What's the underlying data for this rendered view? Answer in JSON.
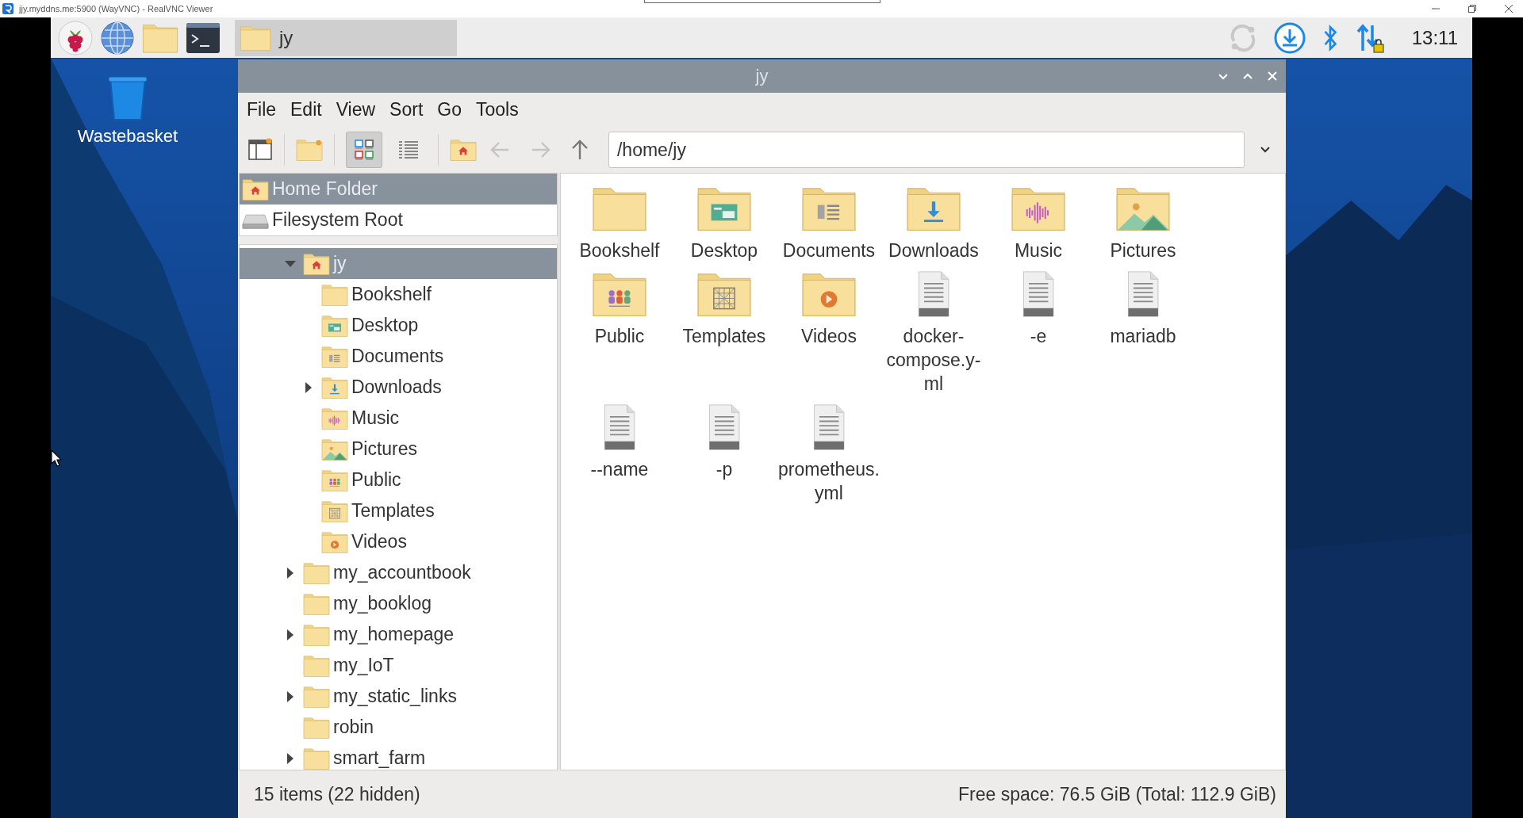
{
  "viewer_window": {
    "title": "jjy.myddns.me:5900 (WayVNC) - RealVNC Viewer"
  },
  "taskbar": {
    "task_buttons": [
      {
        "label": "jy",
        "selected": true
      }
    ],
    "clock": "13:11"
  },
  "desktop_icons": [
    {
      "label": "Wastebasket"
    }
  ],
  "file_manager": {
    "title": "jy",
    "menu": [
      "File",
      "Edit",
      "View",
      "Sort",
      "Go",
      "Tools"
    ],
    "view_modes": [
      {
        "kind": "icons",
        "selected": true
      },
      {
        "kind": "list",
        "selected": false
      }
    ],
    "navigation": [
      {
        "kind": "back",
        "disabled": true
      },
      {
        "kind": "forward",
        "disabled": true
      },
      {
        "kind": "up",
        "disabled": false
      }
    ],
    "path": "/home/jy",
    "places": [
      {
        "label": "Home Folder",
        "kind": "home",
        "selected": true
      },
      {
        "label": "Filesystem Root",
        "kind": "drive",
        "selected": false
      }
    ],
    "tree": [
      {
        "label": "jy",
        "kind": "home",
        "expandable": true,
        "expanded": true,
        "selected": true,
        "children": [
          {
            "label": "Bookshelf",
            "kind": "plain",
            "expandable": false,
            "selected": false
          },
          {
            "label": "Desktop",
            "kind": "desktop",
            "expandable": false,
            "selected": false
          },
          {
            "label": "Documents",
            "kind": "documents",
            "expandable": false,
            "selected": false
          },
          {
            "label": "Downloads",
            "kind": "downloads",
            "expandable": true,
            "expanded": false,
            "selected": false
          },
          {
            "label": "Music",
            "kind": "music",
            "expandable": false,
            "selected": false
          },
          {
            "label": "Pictures",
            "kind": "pictures",
            "expandable": false,
            "selected": false
          },
          {
            "label": "Public",
            "kind": "public",
            "expandable": false,
            "selected": false
          },
          {
            "label": "Templates",
            "kind": "templates",
            "expandable": false,
            "selected": false
          },
          {
            "label": "Videos",
            "kind": "videos",
            "expandable": false,
            "selected": false
          }
        ]
      },
      {
        "label": "my_accountbook",
        "kind": "plain",
        "expandable": true,
        "expanded": false,
        "selected": false
      },
      {
        "label": "my_booklog",
        "kind": "plain",
        "expandable": false,
        "selected": false
      },
      {
        "label": "my_homepage",
        "kind": "plain",
        "expandable": true,
        "expanded": false,
        "selected": false
      },
      {
        "label": "my_IoT",
        "kind": "plain",
        "expandable": false,
        "selected": false
      },
      {
        "label": "my_static_links",
        "kind": "plain",
        "expandable": true,
        "expanded": false,
        "selected": false
      },
      {
        "label": "robin",
        "kind": "plain",
        "expandable": false,
        "selected": false
      },
      {
        "label": "smart_farm",
        "kind": "plain",
        "expandable": true,
        "expanded": false,
        "selected": false
      }
    ],
    "items": [
      {
        "label": "Bookshelf",
        "kind": "plain"
      },
      {
        "label": "Desktop",
        "kind": "desktop"
      },
      {
        "label": "Documents",
        "kind": "documents"
      },
      {
        "label": "Downloads",
        "kind": "downloads"
      },
      {
        "label": "Music",
        "kind": "music"
      },
      {
        "label": "Pictures",
        "kind": "pictures"
      },
      {
        "label": "Public",
        "kind": "public"
      },
      {
        "label": "Templates",
        "kind": "templates"
      },
      {
        "label": "Videos",
        "kind": "videos"
      },
      {
        "label": "docker-compose.y-ml",
        "kind": "file"
      },
      {
        "label": "-e",
        "kind": "file"
      },
      {
        "label": "mariadb",
        "kind": "file"
      },
      {
        "label": "--name",
        "kind": "file"
      },
      {
        "label": "-p",
        "kind": "file"
      },
      {
        "label": "prometheus.yml",
        "kind": "file"
      }
    ],
    "status_left": "15 items (22 hidden)",
    "status_right": "Free space: 76.5 GiB (Total: 112.9 GiB)"
  }
}
